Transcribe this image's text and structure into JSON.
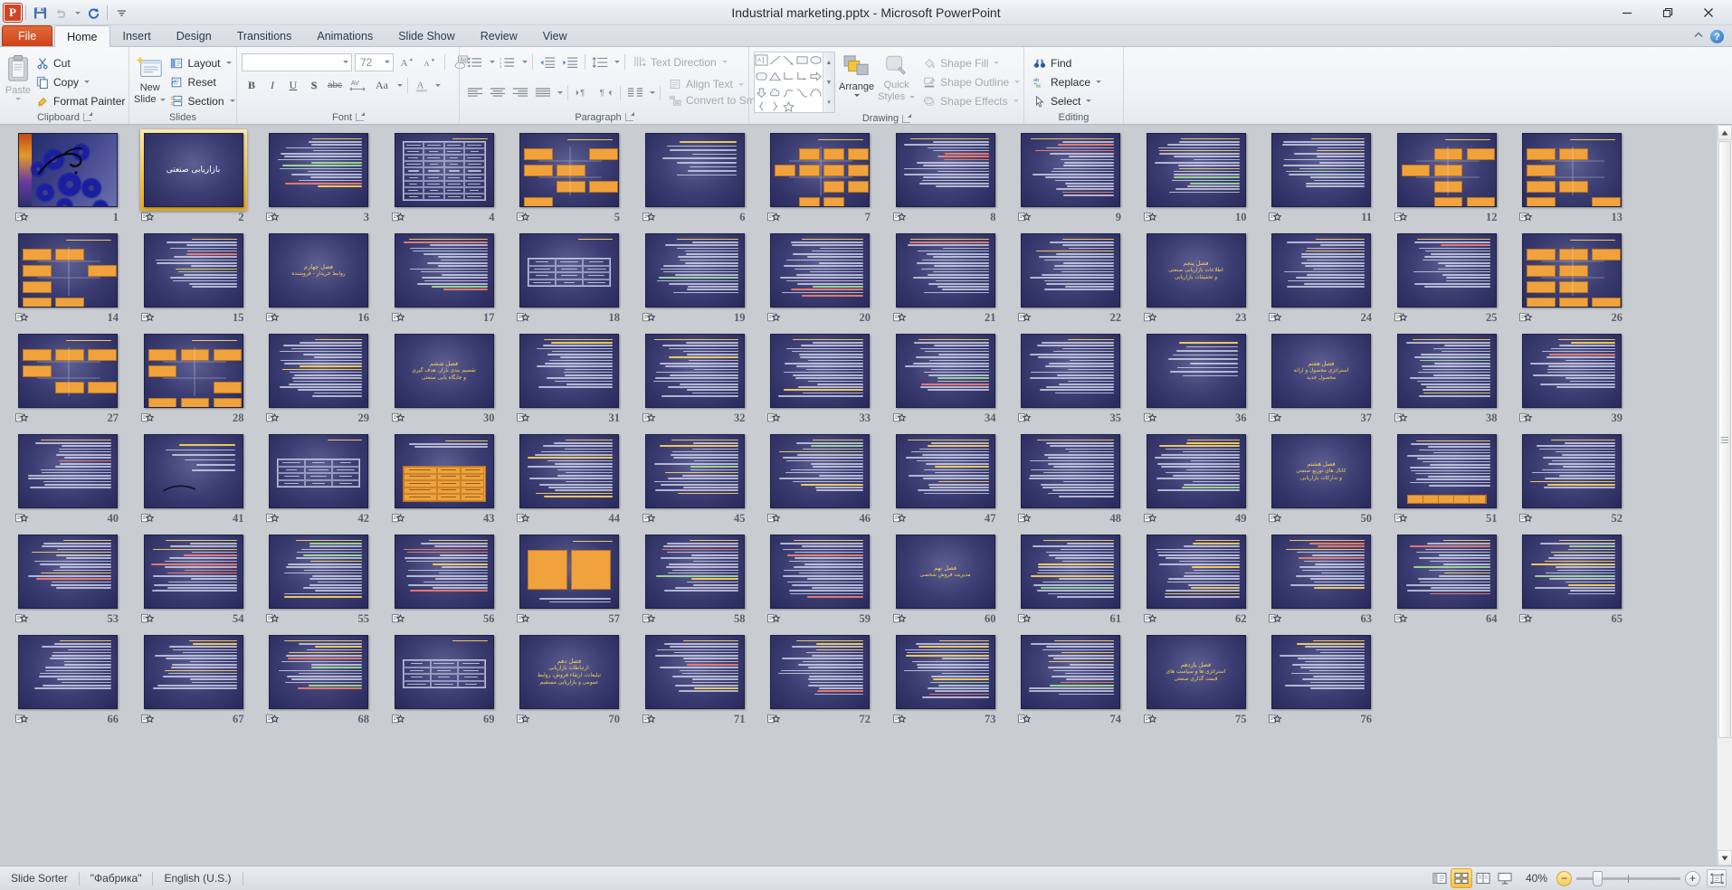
{
  "window": {
    "title": "Industrial marketing.pptx  -  Microsoft PowerPoint",
    "minimize_label": "—",
    "restore_label": "❐",
    "close_label": "✕"
  },
  "quick_access": {
    "app_logo": "powerpoint-logo",
    "items": [
      {
        "name": "save-icon",
        "glyph": "💾",
        "tooltip": "Save"
      },
      {
        "name": "undo-icon",
        "glyph": "↶",
        "tooltip": "Undo"
      },
      {
        "name": "redo-icon",
        "glyph": "↻",
        "tooltip": "Repeat"
      },
      {
        "name": "customize-qat-icon",
        "glyph": "▾",
        "tooltip": "Customize Quick Access Toolbar"
      }
    ]
  },
  "tabs": [
    {
      "label": "File",
      "kind": "file"
    },
    {
      "label": "Home",
      "kind": "active"
    },
    {
      "label": "Insert",
      "kind": "normal"
    },
    {
      "label": "Design",
      "kind": "normal"
    },
    {
      "label": "Transitions",
      "kind": "normal"
    },
    {
      "label": "Animations",
      "kind": "normal"
    },
    {
      "label": "Slide Show",
      "kind": "normal"
    },
    {
      "label": "Review",
      "kind": "normal"
    },
    {
      "label": "View",
      "kind": "normal"
    }
  ],
  "tabbar_right": {
    "minimize_ribbon": "chevron-up-icon",
    "help": "?"
  },
  "ribbon": {
    "groups": [
      {
        "label": "Clipboard",
        "has_launcher": true
      },
      {
        "label": "Slides",
        "has_launcher": false
      },
      {
        "label": "Font",
        "has_launcher": true
      },
      {
        "label": "Paragraph",
        "has_launcher": true
      },
      {
        "label": "Drawing",
        "has_launcher": true
      },
      {
        "label": "Editing",
        "has_launcher": false
      }
    ],
    "clipboard": {
      "paste_label": "Paste",
      "cut_label": "Cut",
      "copy_label": "Copy",
      "format_painter_label": "Format Painter"
    },
    "slides": {
      "new_slide_label": "New\nSlide",
      "new_slide_line1": "New",
      "new_slide_line2": "Slide",
      "layout_label": "Layout",
      "reset_label": "Reset",
      "section_label": "Section"
    },
    "font": {
      "font_name_value": "",
      "font_size_value": "72",
      "buttons": [
        {
          "name": "grow-font-icon",
          "label": "A↑"
        },
        {
          "name": "shrink-font-icon",
          "label": "A↓"
        },
        {
          "name": "clear-formatting-icon",
          "label": "Aa"
        },
        {
          "name": "bold-icon",
          "label": "B"
        },
        {
          "name": "italic-icon",
          "label": "I"
        },
        {
          "name": "underline-icon",
          "label": "U"
        },
        {
          "name": "shadow-icon",
          "label": "S"
        },
        {
          "name": "strikethrough-icon",
          "label": "abc"
        },
        {
          "name": "character-spacing-icon",
          "label": "AV"
        },
        {
          "name": "change-case-icon",
          "label": "Aa"
        },
        {
          "name": "font-color-icon",
          "label": "A"
        }
      ]
    },
    "paragraph": {
      "text_direction_label": "Text Direction",
      "align_text_label": "Align Text",
      "convert_smartart_label": "Convert to SmartArt",
      "buttons": [
        {
          "name": "bullets-icon"
        },
        {
          "name": "numbering-icon"
        },
        {
          "name": "decrease-indent-icon"
        },
        {
          "name": "increase-indent-icon"
        },
        {
          "name": "line-spacing-icon"
        },
        {
          "name": "align-left-icon"
        },
        {
          "name": "align-center-icon"
        },
        {
          "name": "align-right-icon"
        },
        {
          "name": "justify-icon"
        },
        {
          "name": "ltr-icon"
        },
        {
          "name": "rtl-icon"
        },
        {
          "name": "columns-icon"
        }
      ]
    },
    "drawing": {
      "arrange_label": "Arrange",
      "quick_styles_line1": "Quick",
      "quick_styles_line2": "Styles",
      "shape_fill_label": "Shape Fill",
      "shape_outline_label": "Shape Outline",
      "shape_effects_label": "Shape Effects",
      "shapes": [
        "textbox-shape",
        "line-shape",
        "arrow-shape",
        "rectangle-shape",
        "oval-shape",
        "rounded-rect-shape",
        "triangle-shape",
        "elbow-connector-shape",
        "elbow-arrow-shape",
        "right-arrow-shape",
        "down-arrow-shape",
        "cloud-shape",
        "scribble-shape",
        "curve-shape",
        "arc-shape",
        "left-brace-shape",
        "right-brace-shape",
        "star-shape"
      ],
      "scroll_up": "▲",
      "scroll_down": "▼",
      "scroll_more": "▾"
    },
    "editing": {
      "find_label": "Find",
      "replace_label": "Replace",
      "select_label": "Select"
    }
  },
  "status_bar": {
    "view_name": "Slide Sorter",
    "theme_name": "\"Фабрика\"",
    "language": "English (U.S.)",
    "zoom_level": "40%",
    "zoom_out_label": "−",
    "zoom_in_label": "+",
    "views": [
      {
        "name": "normal-view-button",
        "active": false
      },
      {
        "name": "slide-sorter-view-button",
        "active": true
      },
      {
        "name": "reading-view-button",
        "active": false
      },
      {
        "name": "slide-show-button",
        "active": false
      }
    ],
    "fit_to_window": "fit-slide-to-window-button"
  },
  "sorter": {
    "selected_slide": 2,
    "total_visible": 70,
    "columns": 13,
    "rows": 6,
    "scroll": {
      "up_arrow": "▲",
      "down_arrow": "▼"
    },
    "slides": [
      {
        "n": 1,
        "kind": "cover-gears",
        "title": ""
      },
      {
        "n": 2,
        "kind": "title",
        "title": "بازاریابی صنعتی"
      },
      {
        "n": 3,
        "kind": "text-dense",
        "title": ""
      },
      {
        "n": 4,
        "kind": "table",
        "title": ""
      },
      {
        "n": 5,
        "kind": "diagram",
        "title": ""
      },
      {
        "n": 6,
        "kind": "text-light",
        "title": ""
      },
      {
        "n": 7,
        "kind": "diagram-wide",
        "title": ""
      },
      {
        "n": 8,
        "kind": "text-dense",
        "title": ""
      },
      {
        "n": 9,
        "kind": "text-dense",
        "title": ""
      },
      {
        "n": 10,
        "kind": "text-dense",
        "title": ""
      },
      {
        "n": 11,
        "kind": "text-dense",
        "title": ""
      },
      {
        "n": 12,
        "kind": "diagram",
        "title": ""
      },
      {
        "n": 13,
        "kind": "diagram",
        "title": ""
      },
      {
        "n": 14,
        "kind": "diagram",
        "title": ""
      },
      {
        "n": 15,
        "kind": "text-dense",
        "title": ""
      },
      {
        "n": 16,
        "kind": "chapter",
        "title": "فصل چهارم\nروابط خریدار - فروشنده"
      },
      {
        "n": 17,
        "kind": "text-dense",
        "title": ""
      },
      {
        "n": 18,
        "kind": "table-small",
        "title": ""
      },
      {
        "n": 19,
        "kind": "text-dense",
        "title": ""
      },
      {
        "n": 20,
        "kind": "text-dense",
        "title": ""
      },
      {
        "n": 21,
        "kind": "text-dense",
        "title": ""
      },
      {
        "n": 22,
        "kind": "text-dense",
        "title": ""
      },
      {
        "n": 23,
        "kind": "chapter",
        "title": "فصل پنجم\nاطلاعات بازاریابی صنعتی\nو تحقیقات بازاریابی"
      },
      {
        "n": 24,
        "kind": "text-dense",
        "title": ""
      },
      {
        "n": 25,
        "kind": "text-dense",
        "title": ""
      },
      {
        "n": 26,
        "kind": "diagram",
        "title": ""
      },
      {
        "n": 27,
        "kind": "diagram",
        "title": ""
      },
      {
        "n": 28,
        "kind": "diagram",
        "title": ""
      },
      {
        "n": 29,
        "kind": "text-dense",
        "title": ""
      },
      {
        "n": 30,
        "kind": "chapter",
        "title": "فصل ششم\nتقسیم بندی بازار، هدف گیری\nو جایگاه یابی صنعتی"
      },
      {
        "n": 31,
        "kind": "text-dense",
        "title": ""
      },
      {
        "n": 32,
        "kind": "text-dense",
        "title": ""
      },
      {
        "n": 33,
        "kind": "text-dense",
        "title": ""
      },
      {
        "n": 34,
        "kind": "text-dense",
        "title": ""
      },
      {
        "n": 35,
        "kind": "text-dense",
        "title": ""
      },
      {
        "n": 36,
        "kind": "text-light",
        "title": ""
      },
      {
        "n": 37,
        "kind": "chapter",
        "title": "فصل هفتم\nاستراتژی محصول و ارائه\nمحصول جدید"
      },
      {
        "n": 38,
        "kind": "text-dense",
        "title": ""
      },
      {
        "n": 39,
        "kind": "text-dense",
        "title": ""
      },
      {
        "n": 40,
        "kind": "text-dense",
        "title": ""
      },
      {
        "n": 41,
        "kind": "text-sparse",
        "title": ""
      },
      {
        "n": 42,
        "kind": "table-small",
        "title": ""
      },
      {
        "n": 43,
        "kind": "orange-table",
        "title": ""
      },
      {
        "n": 44,
        "kind": "text-dense",
        "title": ""
      },
      {
        "n": 45,
        "kind": "text-dense",
        "title": ""
      },
      {
        "n": 46,
        "kind": "text-dense",
        "title": ""
      },
      {
        "n": 47,
        "kind": "text-dense",
        "title": ""
      },
      {
        "n": 48,
        "kind": "text-dense",
        "title": ""
      },
      {
        "n": 49,
        "kind": "text-dense",
        "title": ""
      },
      {
        "n": 50,
        "kind": "chapter",
        "title": "فصل هشتم\nکانال های توزیع صنعتی\nو تدارکات بازاریابی"
      },
      {
        "n": 51,
        "kind": "orange-strip",
        "title": ""
      },
      {
        "n": 52,
        "kind": "text-dense",
        "title": ""
      },
      {
        "n": 53,
        "kind": "text-dense",
        "title": ""
      },
      {
        "n": 54,
        "kind": "text-dense",
        "title": ""
      },
      {
        "n": 55,
        "kind": "text-dense",
        "title": ""
      },
      {
        "n": 56,
        "kind": "text-dense",
        "title": ""
      },
      {
        "n": 57,
        "kind": "orange-boxes",
        "title": ""
      },
      {
        "n": 58,
        "kind": "text-dense",
        "title": ""
      },
      {
        "n": 59,
        "kind": "text-dense",
        "title": ""
      },
      {
        "n": 60,
        "kind": "chapter",
        "title": "فصل نهم\nمدیریت فروش شخصی"
      },
      {
        "n": 61,
        "kind": "text-dense",
        "title": ""
      },
      {
        "n": 62,
        "kind": "text-dense",
        "title": ""
      },
      {
        "n": 63,
        "kind": "text-dense",
        "title": ""
      },
      {
        "n": 64,
        "kind": "text-dense",
        "title": ""
      },
      {
        "n": 65,
        "kind": "text-dense",
        "title": ""
      },
      {
        "n": 66,
        "kind": "text-dense",
        "title": ""
      },
      {
        "n": 67,
        "kind": "text-dense",
        "title": ""
      },
      {
        "n": 68,
        "kind": "text-dense",
        "title": ""
      },
      {
        "n": 69,
        "kind": "table-small",
        "title": ""
      },
      {
        "n": 70,
        "kind": "chapter",
        "title": "فصل دهم\nارتباطات بازاریابی:\nتبلیغات، ارتقاء فروش، روابط\nعمومی و بازاریابی مستقیم"
      },
      {
        "n": 71,
        "kind": "text-dense",
        "title": ""
      },
      {
        "n": 72,
        "kind": "text-dense",
        "title": ""
      },
      {
        "n": 73,
        "kind": "text-dense",
        "title": ""
      },
      {
        "n": 74,
        "kind": "text-dense",
        "title": ""
      },
      {
        "n": 75,
        "kind": "chapter",
        "title": "فصل یازدهم\nاستراتژی ها و سیاست های\nقیمت گذاری صنعتی"
      },
      {
        "n": 76,
        "kind": "text-dense",
        "title": ""
      }
    ]
  }
}
